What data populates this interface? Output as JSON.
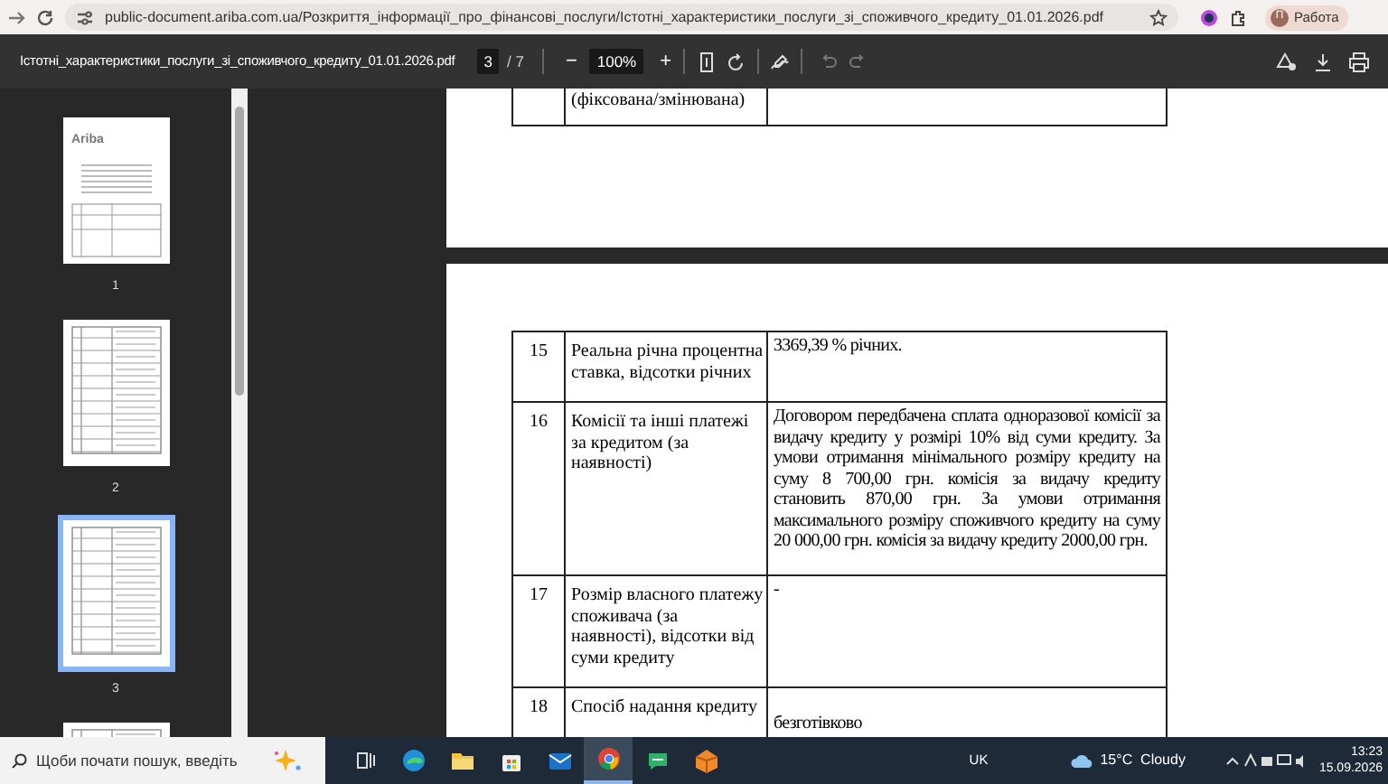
{
  "browser": {
    "url": "public-document.ariba.com.ua/Розкриття_інформації_про_фінансові_послуги/Істотні_характеристики_послуги_зі_споживчого_кредиту_01.01.2026.pdf",
    "profile": "Работа",
    "profile_initial": "П"
  },
  "pdf_toolbar": {
    "filename": "Істотні_характеристики_послуги_зі_споживчого_кредиту_01.01.2026.pdf",
    "page_current": "3",
    "page_total": "/ 7",
    "zoom_out": "−",
    "zoom": "100%",
    "zoom_in": "+"
  },
  "thumbnails": [
    {
      "label": "1",
      "selected": false,
      "logo": "Ariba"
    },
    {
      "label": "2",
      "selected": false
    },
    {
      "label": "3",
      "selected": true
    },
    {
      "selected": false
    }
  ],
  "document": {
    "top_fragment": "(фіксована/змінювана)",
    "rows": [
      {
        "number": "15",
        "parameter": "Реальна річна процентна ставка, відсотки річних",
        "value": "3369,39 % річних."
      },
      {
        "number": "16",
        "parameter": "Комісії та інші платежі за кредитом (за наявності)",
        "value": "Договором передбачена сплата одноразової комісії за видачу кредиту у розмірі 10% від суми кредиту. За умови отримання мінімального розміру кредиту на суму 8 700,00 грн. комісія за видачу кредиту становить 870,00 грн. За умови отримання максимального розміру споживчого кредиту на суму 20 000,00 грн. комісія за видачу кредиту 2000,00 грн."
      },
      {
        "number": "17",
        "parameter": "Розмір власного платежу споживача (за наявності), відсотки від суми кредиту",
        "value": "-"
      },
      {
        "number": "18",
        "parameter": "Спосіб надання кредиту",
        "value": "безготівково"
      }
    ]
  },
  "taskbar": {
    "search_placeholder": "Щоби почати пошук, введіть",
    "apps": [
      {
        "kind": "taskview",
        "selected": false
      },
      {
        "kind": "edge",
        "selected": false
      },
      {
        "kind": "explorer",
        "selected": false
      },
      {
        "kind": "store",
        "selected": false
      },
      {
        "kind": "mail",
        "selected": false
      },
      {
        "kind": "chrome",
        "selected": true
      },
      {
        "kind": "chat",
        "selected": false
      },
      {
        "kind": "fox",
        "selected": false
      }
    ],
    "language": "UK",
    "weather": "15°C  Cloudy",
    "time": "13:23",
    "date": "15.09.2026"
  }
}
